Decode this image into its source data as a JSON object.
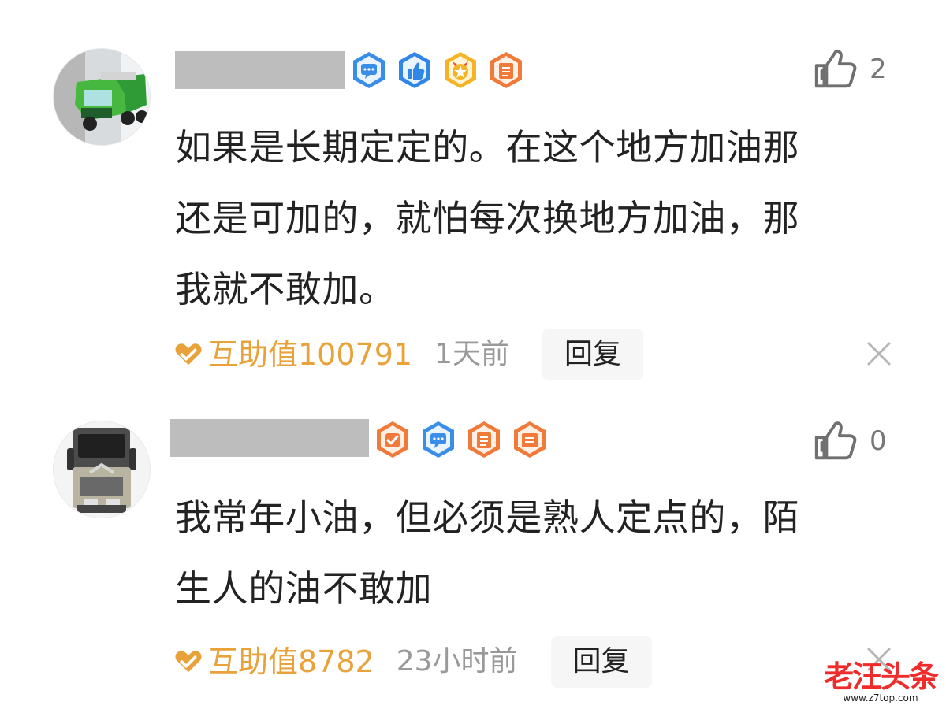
{
  "comments": [
    {
      "avatar": "green-truck-avatar",
      "username": "",
      "badges": [
        "chat-badge",
        "thumbs-up-badge",
        "star-badge",
        "document-badge"
      ],
      "likes": "2",
      "text": "如果是长期定定的。在这个地方加油那\n还是可加的，就怕每次换地方加油，那\n我就不敢加。",
      "help_value": "互助值100791",
      "time": "1天前",
      "reply_label": "回复"
    },
    {
      "avatar": "volvo-truck-avatar",
      "username": "",
      "badges": [
        "check-badge",
        "chat-badge",
        "document-badge",
        "document-badge"
      ],
      "likes": "0",
      "text": "我常年小油，但必须是熟人定点的，陌\n生人的油不敢加",
      "help_value": "互助值8782",
      "time": "23小时前",
      "reply_label": "回复"
    }
  ],
  "watermark": {
    "main": "老汪头条",
    "url": "www.z7top.com"
  },
  "colors": {
    "orange": "#e9a23a",
    "blue": "#3b8ee8",
    "red_watermark": "#ef2c2c",
    "gray_text": "#999999"
  }
}
